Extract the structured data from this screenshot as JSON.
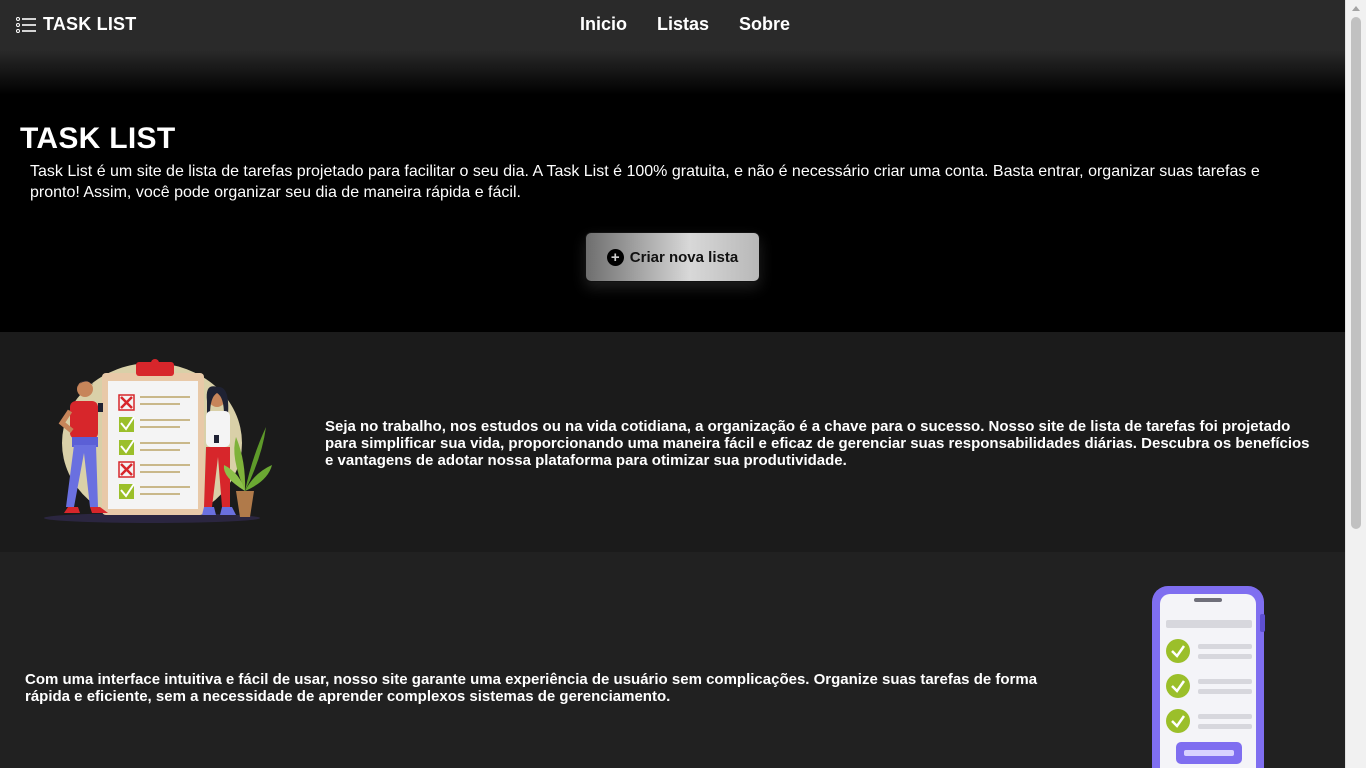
{
  "header": {
    "brand_icon": "list-icon",
    "brand_name": "TASK LIST",
    "nav": [
      {
        "label": "Inicio"
      },
      {
        "label": "Listas"
      },
      {
        "label": "Sobre"
      }
    ]
  },
  "hero": {
    "title": "TASK LIST",
    "description": "Task List é um site de lista de tarefas projetado para facilitar o seu dia. A Task List é 100% gratuita, e não é necessário criar uma conta. Basta entrar, organizar suas tarefas e pronto! Assim, você pode organizar seu dia de maneira rápida e fácil.",
    "cta_icon": "plus-circle-icon",
    "cta_label": "Criar nova lista"
  },
  "section1": {
    "illustration": "checklist-people-illustration",
    "text": "Seja no trabalho, nos estudos ou na vida cotidiana, a organização é a chave para o sucesso. Nosso site de lista de tarefas foi projetado para simplificar sua vida, proporcionando uma maneira fácil e eficaz de gerenciar suas responsabilidades diárias. Descubra os benefícios e vantagens de adotar nossa plataforma para otimizar sua produtividade."
  },
  "section2": {
    "text": "Com uma interface intuitiva e fácil de usar, nosso site garante uma experiência de usuário sem complicações. Organize suas tarefas de forma rápida e eficiente, sem a necessidade de aprender complexos sistemas de gerenciamento.",
    "illustration": "phone-checklist-illustration"
  },
  "colors": {
    "header_bg": "#2a2a2a",
    "hero_bg": "#000000",
    "section1_bg": "#1b1b1b",
    "section2_bg": "#212121",
    "check_green": "#9bbf2a",
    "cross_red": "#d7262b",
    "phone_purple": "#7f6ef0"
  }
}
